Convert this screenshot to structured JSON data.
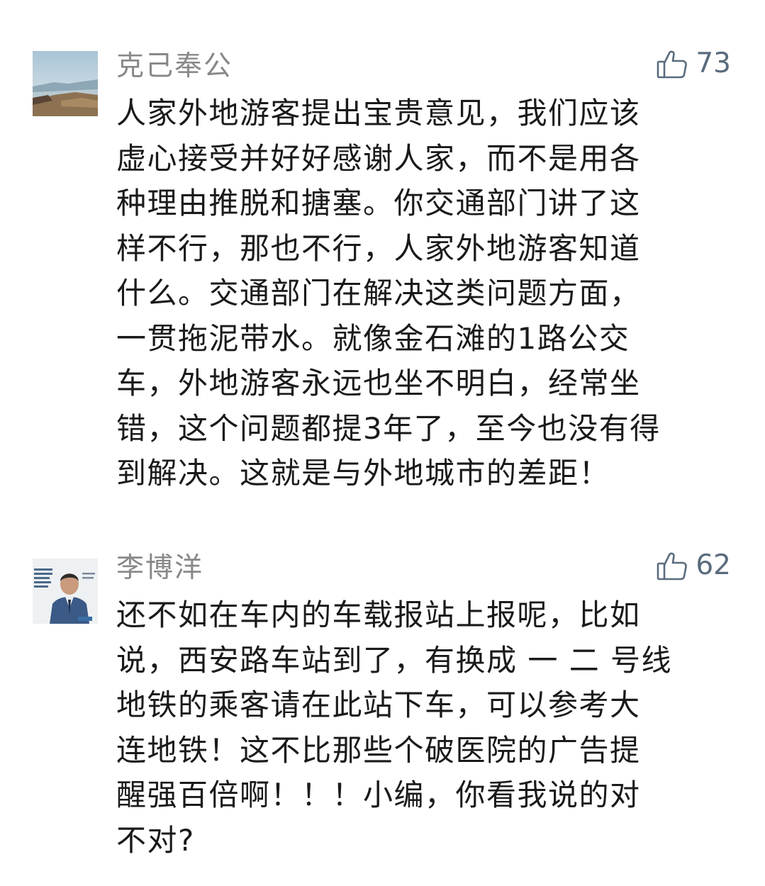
{
  "comments": [
    {
      "username": "克己奉公",
      "likes": "73",
      "avatar_icon": "landscape-avatar-icon",
      "body": "人家外地游客提出宝贵意见，我们应该\n虚心接受并好好感谢人家，而不是用各\n种理由推脱和搪塞。你交通部门讲了这\n样不行，那也不行，人家外地游客知道\n什么。交通部门在解决这类问题方面，\n一贯拖泥带水。就像金石滩的1路公交\n车，外地游客永远也坐不明白，经常坐\n错，这个问题都提3年了，至今也没有得\n到解决。这就是与外地城市的差距！"
    },
    {
      "username": "李博洋",
      "likes": "62",
      "avatar_icon": "portrait-avatar-icon",
      "body": "还不如在车内的车载报站上报呢，比如\n说，西安路车站到了，有换成 一 二 号线\n地铁的乘客请在此站下车，可以参考大\n连地铁！这不比那些个破医院的广告提\n醒强百倍啊！！！小编，你看我说的对\n不对?"
    }
  ],
  "colors": {
    "username": "#888888",
    "like": "#5a6b7d",
    "text": "#1a1a1a",
    "background": "#ffffff"
  }
}
